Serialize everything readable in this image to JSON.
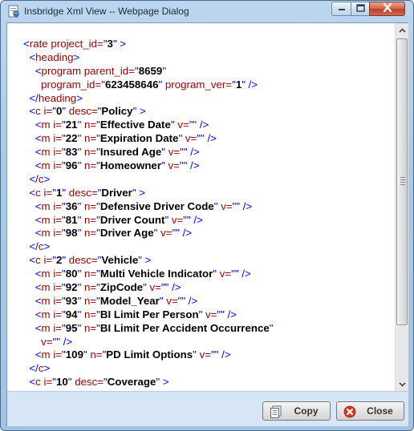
{
  "window": {
    "title": "Insbridge Xml View -- Webpage Dialog",
    "icon": "ie-document-icon",
    "controls": {
      "minimize": "minimize-icon",
      "maximize": "maximize-icon",
      "close": "close-x-icon"
    }
  },
  "xml_lines": [
    [
      [
        "mk",
        "<"
      ],
      [
        "tg",
        "rate"
      ],
      [
        "an",
        " project_id="
      ],
      [
        "mk",
        "\""
      ],
      [
        "av",
        "3"
      ],
      [
        "mk",
        "\""
      ],
      [
        "mk",
        " >"
      ]
    ],
    [
      [
        "mk",
        "  <"
      ],
      [
        "tg",
        "heading"
      ],
      [
        "mk",
        ">"
      ]
    ],
    [
      [
        "mk",
        "    <"
      ],
      [
        "tg",
        "program"
      ],
      [
        "an",
        " parent_id="
      ],
      [
        "mk",
        "\""
      ],
      [
        "av",
        "8659"
      ],
      [
        "mk",
        "\""
      ]
    ],
    [
      [
        "an",
        "      program_id="
      ],
      [
        "mk",
        "\""
      ],
      [
        "av",
        "623458646"
      ],
      [
        "mk",
        "\""
      ],
      [
        "an",
        " program_ver="
      ],
      [
        "mk",
        "\""
      ],
      [
        "av",
        "1"
      ],
      [
        "mk",
        "\""
      ],
      [
        "mk",
        " />"
      ]
    ],
    [
      [
        "mk",
        "  </"
      ],
      [
        "tg",
        "heading"
      ],
      [
        "mk",
        ">"
      ]
    ],
    [
      [
        "mk",
        "  <"
      ],
      [
        "tg",
        "c"
      ],
      [
        "an",
        " i="
      ],
      [
        "mk",
        "\""
      ],
      [
        "av",
        "0"
      ],
      [
        "mk",
        "\""
      ],
      [
        "an",
        " desc="
      ],
      [
        "mk",
        "\""
      ],
      [
        "av",
        "Policy"
      ],
      [
        "mk",
        "\""
      ],
      [
        "mk",
        " >"
      ]
    ],
    [
      [
        "mk",
        "    <"
      ],
      [
        "tg",
        "m"
      ],
      [
        "an",
        " i="
      ],
      [
        "mk",
        "\""
      ],
      [
        "av",
        "21"
      ],
      [
        "mk",
        "\""
      ],
      [
        "an",
        " n="
      ],
      [
        "mk",
        "\""
      ],
      [
        "av",
        "Effective Date"
      ],
      [
        "mk",
        "\""
      ],
      [
        "an",
        " v="
      ],
      [
        "mk",
        "\"\""
      ],
      [
        "mk",
        " />"
      ]
    ],
    [
      [
        "mk",
        "    <"
      ],
      [
        "tg",
        "m"
      ],
      [
        "an",
        " i="
      ],
      [
        "mk",
        "\""
      ],
      [
        "av",
        "22"
      ],
      [
        "mk",
        "\""
      ],
      [
        "an",
        " n="
      ],
      [
        "mk",
        "\""
      ],
      [
        "av",
        "Expiration Date"
      ],
      [
        "mk",
        "\""
      ],
      [
        "an",
        " v="
      ],
      [
        "mk",
        "\"\""
      ],
      [
        "mk",
        " />"
      ]
    ],
    [
      [
        "mk",
        "    <"
      ],
      [
        "tg",
        "m"
      ],
      [
        "an",
        " i="
      ],
      [
        "mk",
        "\""
      ],
      [
        "av",
        "83"
      ],
      [
        "mk",
        "\""
      ],
      [
        "an",
        " n="
      ],
      [
        "mk",
        "\""
      ],
      [
        "av",
        "Insured Age"
      ],
      [
        "mk",
        "\""
      ],
      [
        "an",
        " v="
      ],
      [
        "mk",
        "\"\""
      ],
      [
        "mk",
        " />"
      ]
    ],
    [
      [
        "mk",
        "    <"
      ],
      [
        "tg",
        "m"
      ],
      [
        "an",
        " i="
      ],
      [
        "mk",
        "\""
      ],
      [
        "av",
        "96"
      ],
      [
        "mk",
        "\""
      ],
      [
        "an",
        " n="
      ],
      [
        "mk",
        "\""
      ],
      [
        "av",
        "Homeowner"
      ],
      [
        "mk",
        "\""
      ],
      [
        "an",
        " v="
      ],
      [
        "mk",
        "\"\""
      ],
      [
        "mk",
        " />"
      ]
    ],
    [
      [
        "mk",
        "  </"
      ],
      [
        "tg",
        "c"
      ],
      [
        "mk",
        ">"
      ]
    ],
    [
      [
        "mk",
        "  <"
      ],
      [
        "tg",
        "c"
      ],
      [
        "an",
        " i="
      ],
      [
        "mk",
        "\""
      ],
      [
        "av",
        "1"
      ],
      [
        "mk",
        "\""
      ],
      [
        "an",
        " desc="
      ],
      [
        "mk",
        "\""
      ],
      [
        "av",
        "Driver"
      ],
      [
        "mk",
        "\""
      ],
      [
        "mk",
        " >"
      ]
    ],
    [
      [
        "mk",
        "    <"
      ],
      [
        "tg",
        "m"
      ],
      [
        "an",
        " i="
      ],
      [
        "mk",
        "\""
      ],
      [
        "av",
        "36"
      ],
      [
        "mk",
        "\""
      ],
      [
        "an",
        " n="
      ],
      [
        "mk",
        "\""
      ],
      [
        "av",
        "Defensive Driver Code"
      ],
      [
        "mk",
        "\""
      ],
      [
        "an",
        " v="
      ],
      [
        "mk",
        "\"\""
      ],
      [
        "mk",
        " />"
      ]
    ],
    [
      [
        "mk",
        "    <"
      ],
      [
        "tg",
        "m"
      ],
      [
        "an",
        " i="
      ],
      [
        "mk",
        "\""
      ],
      [
        "av",
        "81"
      ],
      [
        "mk",
        "\""
      ],
      [
        "an",
        " n="
      ],
      [
        "mk",
        "\""
      ],
      [
        "av",
        "Driver Count"
      ],
      [
        "mk",
        "\""
      ],
      [
        "an",
        " v="
      ],
      [
        "mk",
        "\"\""
      ],
      [
        "mk",
        " />"
      ]
    ],
    [
      [
        "mk",
        "    <"
      ],
      [
        "tg",
        "m"
      ],
      [
        "an",
        " i="
      ],
      [
        "mk",
        "\""
      ],
      [
        "av",
        "98"
      ],
      [
        "mk",
        "\""
      ],
      [
        "an",
        " n="
      ],
      [
        "mk",
        "\""
      ],
      [
        "av",
        "Driver Age"
      ],
      [
        "mk",
        "\""
      ],
      [
        "an",
        " v="
      ],
      [
        "mk",
        "\"\""
      ],
      [
        "mk",
        " />"
      ]
    ],
    [
      [
        "mk",
        "  </"
      ],
      [
        "tg",
        "c"
      ],
      [
        "mk",
        ">"
      ]
    ],
    [
      [
        "mk",
        "  <"
      ],
      [
        "tg",
        "c"
      ],
      [
        "an",
        " i="
      ],
      [
        "mk",
        "\""
      ],
      [
        "av",
        "2"
      ],
      [
        "mk",
        "\""
      ],
      [
        "an",
        " desc="
      ],
      [
        "mk",
        "\""
      ],
      [
        "av",
        "Vehicle"
      ],
      [
        "mk",
        "\""
      ],
      [
        "mk",
        " >"
      ]
    ],
    [
      [
        "mk",
        "    <"
      ],
      [
        "tg",
        "m"
      ],
      [
        "an",
        " i="
      ],
      [
        "mk",
        "\""
      ],
      [
        "av",
        "80"
      ],
      [
        "mk",
        "\""
      ],
      [
        "an",
        " n="
      ],
      [
        "mk",
        "\""
      ],
      [
        "av",
        "Multi Vehicle Indicator"
      ],
      [
        "mk",
        "\""
      ],
      [
        "an",
        " v="
      ],
      [
        "mk",
        "\"\""
      ],
      [
        "mk",
        " />"
      ]
    ],
    [
      [
        "mk",
        "    <"
      ],
      [
        "tg",
        "m"
      ],
      [
        "an",
        " i="
      ],
      [
        "mk",
        "\""
      ],
      [
        "av",
        "92"
      ],
      [
        "mk",
        "\""
      ],
      [
        "an",
        " n="
      ],
      [
        "mk",
        "\""
      ],
      [
        "av",
        "ZipCode"
      ],
      [
        "mk",
        "\""
      ],
      [
        "an",
        " v="
      ],
      [
        "mk",
        "\"\""
      ],
      [
        "mk",
        " />"
      ]
    ],
    [
      [
        "mk",
        "    <"
      ],
      [
        "tg",
        "m"
      ],
      [
        "an",
        " i="
      ],
      [
        "mk",
        "\""
      ],
      [
        "av",
        "93"
      ],
      [
        "mk",
        "\""
      ],
      [
        "an",
        " n="
      ],
      [
        "mk",
        "\""
      ],
      [
        "av",
        "Model_Year"
      ],
      [
        "mk",
        "\""
      ],
      [
        "an",
        " v="
      ],
      [
        "mk",
        "\"\""
      ],
      [
        "mk",
        " />"
      ]
    ],
    [
      [
        "mk",
        "    <"
      ],
      [
        "tg",
        "m"
      ],
      [
        "an",
        " i="
      ],
      [
        "mk",
        "\""
      ],
      [
        "av",
        "94"
      ],
      [
        "mk",
        "\""
      ],
      [
        "an",
        " n="
      ],
      [
        "mk",
        "\""
      ],
      [
        "av",
        "BI Limit Per Person"
      ],
      [
        "mk",
        "\""
      ],
      [
        "an",
        " v="
      ],
      [
        "mk",
        "\"\""
      ],
      [
        "mk",
        " />"
      ]
    ],
    [
      [
        "mk",
        "    <"
      ],
      [
        "tg",
        "m"
      ],
      [
        "an",
        " i="
      ],
      [
        "mk",
        "\""
      ],
      [
        "av",
        "95"
      ],
      [
        "mk",
        "\""
      ],
      [
        "an",
        " n="
      ],
      [
        "mk",
        "\""
      ],
      [
        "av",
        "BI Limit Per Accident Occurrence"
      ],
      [
        "mk",
        "\""
      ]
    ],
    [
      [
        "an",
        "      v="
      ],
      [
        "mk",
        "\"\""
      ],
      [
        "mk",
        " />"
      ]
    ],
    [
      [
        "mk",
        "    <"
      ],
      [
        "tg",
        "m"
      ],
      [
        "an",
        " i="
      ],
      [
        "mk",
        "\""
      ],
      [
        "av",
        "109"
      ],
      [
        "mk",
        "\""
      ],
      [
        "an",
        " n="
      ],
      [
        "mk",
        "\""
      ],
      [
        "av",
        "PD Limit Options"
      ],
      [
        "mk",
        "\""
      ],
      [
        "an",
        " v="
      ],
      [
        "mk",
        "\"\""
      ],
      [
        "mk",
        " />"
      ]
    ],
    [
      [
        "mk",
        "  </"
      ],
      [
        "tg",
        "c"
      ],
      [
        "mk",
        ">"
      ]
    ],
    [
      [
        "mk",
        "  <"
      ],
      [
        "tg",
        "c"
      ],
      [
        "an",
        " i="
      ],
      [
        "mk",
        "\""
      ],
      [
        "av",
        "10"
      ],
      [
        "mk",
        "\""
      ],
      [
        "an",
        " desc="
      ],
      [
        "mk",
        "\""
      ],
      [
        "av",
        "Coverage"
      ],
      [
        "mk",
        "\""
      ],
      [
        "mk",
        " >"
      ]
    ]
  ],
  "footer": {
    "copy_label": "Copy",
    "copy_icon": "copy-document-icon",
    "close_label": "Close",
    "close_icon": "close-circle-icon"
  },
  "colors": {
    "markup": "#0000ff",
    "tag_name": "#990000",
    "attribute_value": "#000000",
    "footer_bg": "#d6e6f7"
  }
}
